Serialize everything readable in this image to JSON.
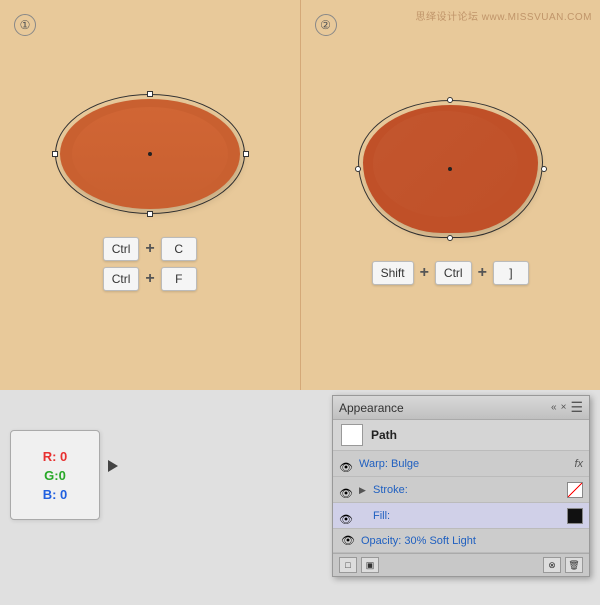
{
  "watermark": {
    "text": "思绎设计论坛  www.MISSVUAN.COM"
  },
  "panels": {
    "left": {
      "number": "①",
      "shortcuts": [
        {
          "keys": [
            "Ctrl",
            "+",
            "C"
          ]
        },
        {
          "keys": [
            "Ctrl",
            "+",
            "F"
          ]
        }
      ]
    },
    "right": {
      "number": "②",
      "shortcut": {
        "keys": [
          "Shift",
          "+",
          "Ctrl",
          "+",
          "]"
        ]
      }
    }
  },
  "rgb": {
    "r": "R: 0",
    "g": "G:0",
    "b": "B: 0"
  },
  "appearance": {
    "title": "Appearance",
    "path_label": "Path",
    "rows": [
      {
        "label": "Warp: Bulge",
        "fx": "fx",
        "type": "warp"
      },
      {
        "label": "Stroke:",
        "type": "stroke",
        "swatch": "x"
      },
      {
        "label": "Fill:",
        "type": "fill",
        "swatch": "black"
      },
      {
        "label": "Opacity:  30% Soft Light",
        "type": "opacity"
      }
    ],
    "footer_buttons": [
      "□",
      "▣",
      "⊗",
      "🗑"
    ]
  }
}
